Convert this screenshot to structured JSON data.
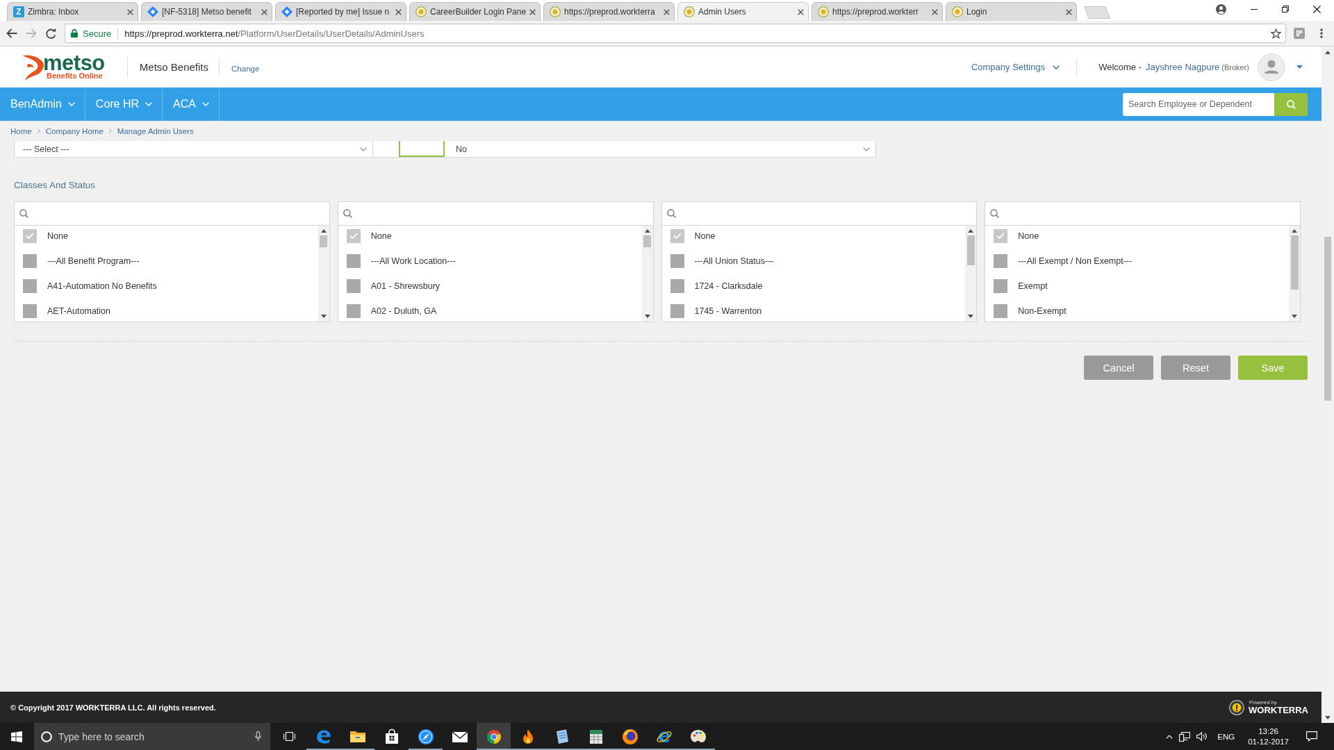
{
  "browser": {
    "tabs": [
      {
        "title": "Zimbra: Inbox",
        "kind": "letter",
        "letter": "Z",
        "selected": false
      },
      {
        "title": "[NF-5318] Metso benefit",
        "kind": "diamond",
        "selected": false
      },
      {
        "title": "[Reported by me] Issue n",
        "kind": "diamond",
        "selected": false
      },
      {
        "title": "CareerBuilder Login Pane",
        "kind": "emblem",
        "selected": false
      },
      {
        "title": "https://preprod.workterra",
        "kind": "emblem",
        "selected": false
      },
      {
        "title": "Admin Users",
        "kind": "emblem",
        "selected": true
      },
      {
        "title": "https://preprod.workterr",
        "kind": "emblem",
        "selected": false
      },
      {
        "title": "Login",
        "kind": "emblem",
        "selected": false
      }
    ],
    "address": {
      "security": "Secure",
      "host": "https://preprod.workterra.net",
      "path": "/Platform/UserDetails/UserDetails/AdminUsers"
    }
  },
  "header": {
    "logo": {
      "name": "metso",
      "tagline": "Benefits Online"
    },
    "company": "Metso Benefits",
    "change_link": "Change",
    "company_settings": "Company Settings",
    "welcome": "Welcome -",
    "user_name": "Jayshree Nagpure",
    "user_role": "(Broker)"
  },
  "nav": {
    "items": [
      {
        "label": "BenAdmin"
      },
      {
        "label": "Core HR"
      },
      {
        "label": "ACA"
      }
    ],
    "search": {
      "placeholder": "Search Employee or Dependent"
    }
  },
  "breadcrumb": [
    {
      "label": "Home"
    },
    {
      "label": "Company Home"
    },
    {
      "label": "Manage Admin Users"
    }
  ],
  "form": {
    "select_1": "--- Select ---",
    "select_2": "No",
    "section_title": "Classes And Status",
    "lists": [
      {
        "items": [
          {
            "label": "None",
            "checked": true
          },
          {
            "label": "---All Benefit Program---",
            "checked": false
          },
          {
            "label": "A41-Automation No Benefits",
            "checked": false
          },
          {
            "label": "AET-Automation",
            "checked": false
          }
        ]
      },
      {
        "items": [
          {
            "label": "None",
            "checked": true
          },
          {
            "label": "---All Work Location---",
            "checked": false
          },
          {
            "label": "A01 - Shrewsbury",
            "checked": false
          },
          {
            "label": "A02 - Duluth, GA",
            "checked": false
          }
        ]
      },
      {
        "items": [
          {
            "label": "None",
            "checked": true
          },
          {
            "label": "---All Union Status---",
            "checked": false
          },
          {
            "label": "1724 - Clarksdale",
            "checked": false
          },
          {
            "label": "1745 - Warrenton",
            "checked": false
          }
        ]
      },
      {
        "items": [
          {
            "label": "None",
            "checked": true
          },
          {
            "label": "---All Exempt / Non Exempt---",
            "checked": false
          },
          {
            "label": "Exempt",
            "checked": false
          },
          {
            "label": "Non-Exempt",
            "checked": false
          }
        ]
      }
    ]
  },
  "buttons": [
    {
      "label": "Cancel",
      "kind": "secondary"
    },
    {
      "label": "Reset",
      "kind": "secondary"
    },
    {
      "label": "Save",
      "kind": "primary"
    }
  ],
  "footer": {
    "copyright": "© Copyright 2017 WORKTERRA LLC. All rights reserved.",
    "powered_by": "Powered by",
    "brand": "WORKTERRA"
  },
  "taskbar": {
    "search": {
      "placeholder": "Type here to search"
    },
    "apps": [
      {
        "kind": "edge",
        "selected": false,
        "running": true
      },
      {
        "kind": "folder",
        "selected": false,
        "running": true
      },
      {
        "kind": "store",
        "selected": false,
        "running": false
      },
      {
        "kind": "compass",
        "selected": false,
        "running": true
      },
      {
        "kind": "mail",
        "selected": false,
        "running": false
      },
      {
        "kind": "chrome",
        "selected": true,
        "running": true
      },
      {
        "kind": "flame",
        "selected": false,
        "running": true
      },
      {
        "kind": "notebook",
        "selected": false,
        "running": true
      },
      {
        "kind": "spreadsheet",
        "selected": false,
        "running": true
      },
      {
        "kind": "firefox",
        "selected": false,
        "running": true
      },
      {
        "kind": "ie",
        "selected": false,
        "running": true
      },
      {
        "kind": "palette",
        "selected": false,
        "running": true
      }
    ],
    "tray": {
      "language": "ENG",
      "time": "13:26",
      "date": "01-12-2017"
    }
  }
}
